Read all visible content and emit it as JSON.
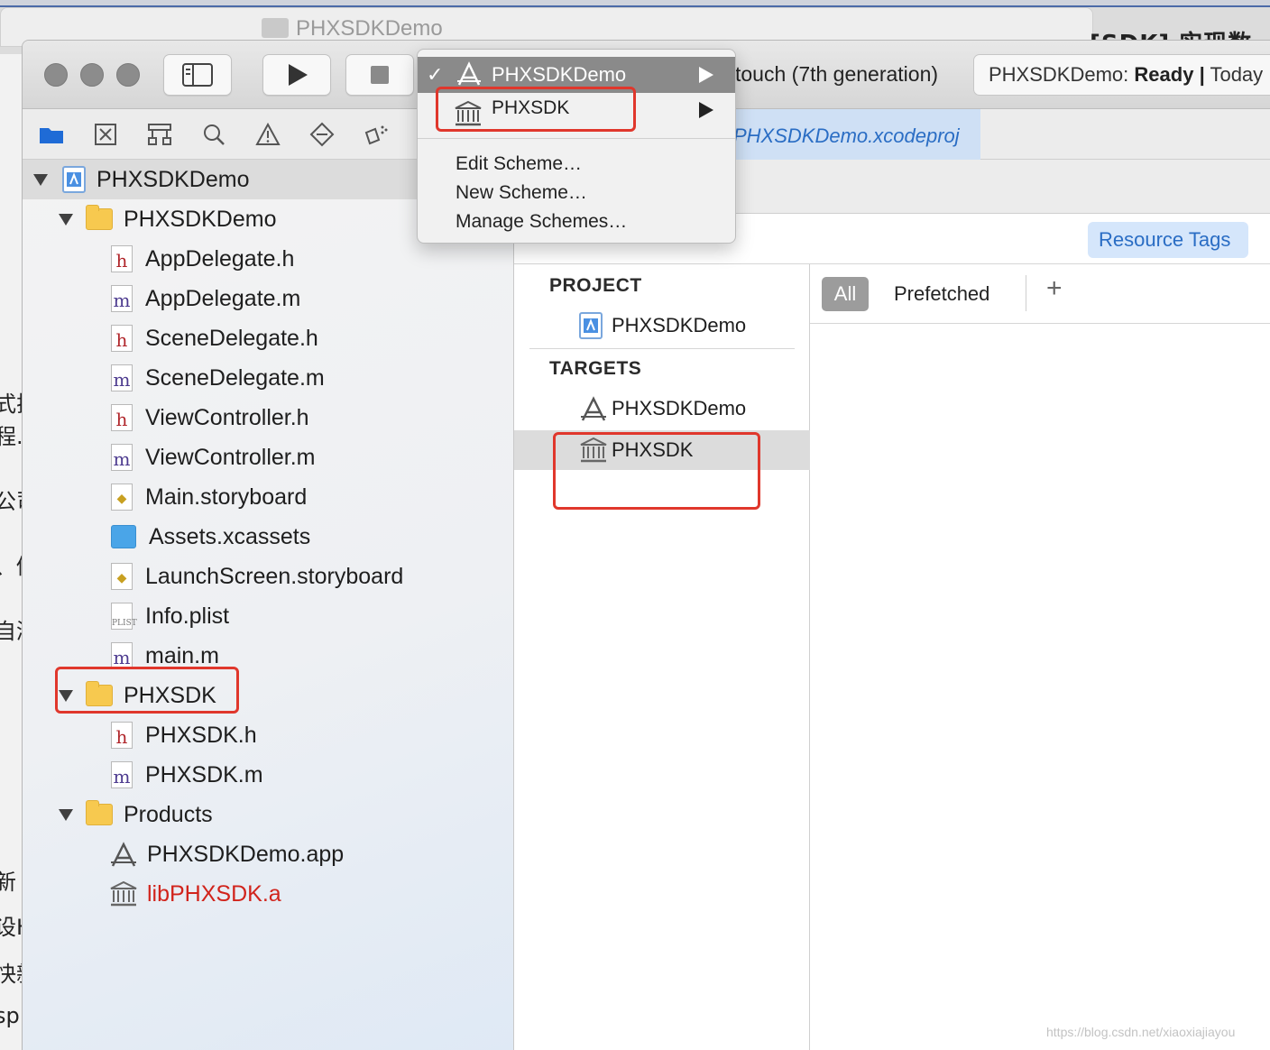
{
  "background": {
    "window_title": "PHXSDKDemo",
    "right_title_fragment": "[SDK] 实现数",
    "left_fragments": [
      "式排",
      "程.x",
      "公司",
      "、修",
      "自测",
      "新",
      "设H",
      "快新",
      "sp"
    ]
  },
  "toolbar": {
    "device_label": "touch (7th generation)",
    "status_project": "PHXSDKDemo:",
    "status_state": "Ready",
    "status_separator": "|",
    "status_time": "Today"
  },
  "scheme_menu": {
    "checkmark": "✓",
    "selected_scheme": "PHXSDKDemo",
    "second_scheme": "PHXSDK",
    "edit_scheme": "Edit Scheme…",
    "new_scheme": "New Scheme…",
    "manage_schemes": "Manage Schemes…"
  },
  "navigator": {
    "project": "PHXSDKDemo",
    "groups": [
      {
        "name": "PHXSDKDemo",
        "files": [
          "AppDelegate.h",
          "AppDelegate.m",
          "SceneDelegate.h",
          "SceneDelegate.m",
          "ViewController.h",
          "ViewController.m",
          "Main.storyboard",
          "Assets.xcassets",
          "LaunchScreen.storyboard",
          "Info.plist",
          "main.m"
        ]
      },
      {
        "name": "PHXSDK",
        "files": [
          "PHXSDK.h",
          "PHXSDK.m"
        ]
      },
      {
        "name": "Products",
        "files": [
          "PHXSDKDemo.app",
          "libPHXSDK.a"
        ]
      }
    ]
  },
  "editor": {
    "path_file": "PHXSDKDemo.xcodeproj",
    "resource_tags_label": "Resource Tags",
    "project_header": "PROJECT",
    "project_item": "PHXSDKDemo",
    "targets_header": "TARGETS",
    "targets": [
      "PHXSDKDemo",
      "PHXSDK"
    ],
    "filter_all": "All",
    "filter_prefetched": "Prefetched",
    "add_symbol": "+"
  },
  "watermark": "https://blog.csdn.net/xiaoxiajiayou",
  "colors": {
    "accent_blue": "#2a6dc4",
    "highlight_red": "#e0372c",
    "missing_product_red": "#d1241c"
  }
}
